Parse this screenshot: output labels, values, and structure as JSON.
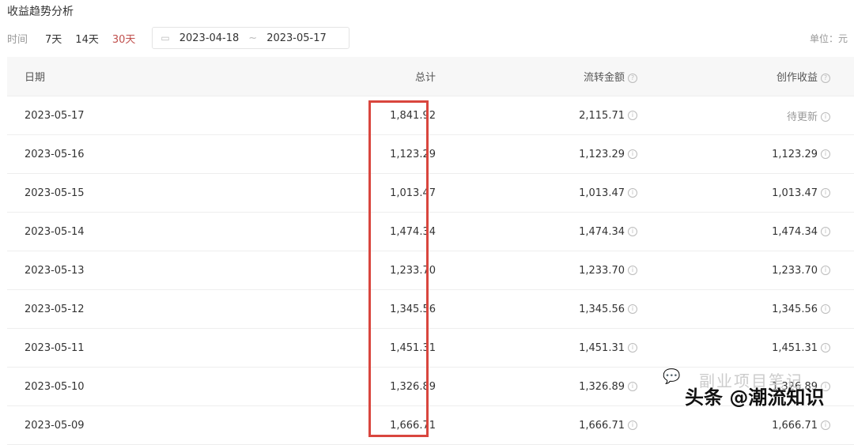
{
  "title": "收益趋势分析",
  "filters": {
    "label": "时间",
    "options": [
      "7天",
      "14天",
      "30天"
    ],
    "active": "30天",
    "start": "2023-04-18",
    "sep": "~",
    "end": "2023-05-17"
  },
  "unit": "单位：元",
  "columns": [
    "日期",
    "总计",
    "流转金额",
    "创作收益"
  ],
  "rows": [
    [
      "2023-05-17",
      "1,841.92",
      "2,115.71",
      "待更新"
    ],
    [
      "2023-05-16",
      "1,123.29",
      "1,123.29",
      "1,123.29"
    ],
    [
      "2023-05-15",
      "1,013.47",
      "1,013.47",
      "1,013.47"
    ],
    [
      "2023-05-14",
      "1,474.34",
      "1,474.34",
      "1,474.34"
    ],
    [
      "2023-05-13",
      "1,233.70",
      "1,233.70",
      "1,233.70"
    ],
    [
      "2023-05-12",
      "1,345.56",
      "1,345.56",
      "1,345.56"
    ],
    [
      "2023-05-11",
      "1,451.31",
      "1,451.31",
      "1,451.31"
    ],
    [
      "2023-05-10",
      "1,326.89",
      "1,326.89",
      "1,326.89"
    ],
    [
      "2023-05-09",
      "1,666.71",
      "1,666.71",
      "1,666.71"
    ]
  ],
  "watermark": {
    "wechat": "副业项目笔记",
    "toutiao": "头条 @潮流知识"
  },
  "colors": {
    "accent": "#c0504d",
    "highlight": "#d9463e"
  }
}
